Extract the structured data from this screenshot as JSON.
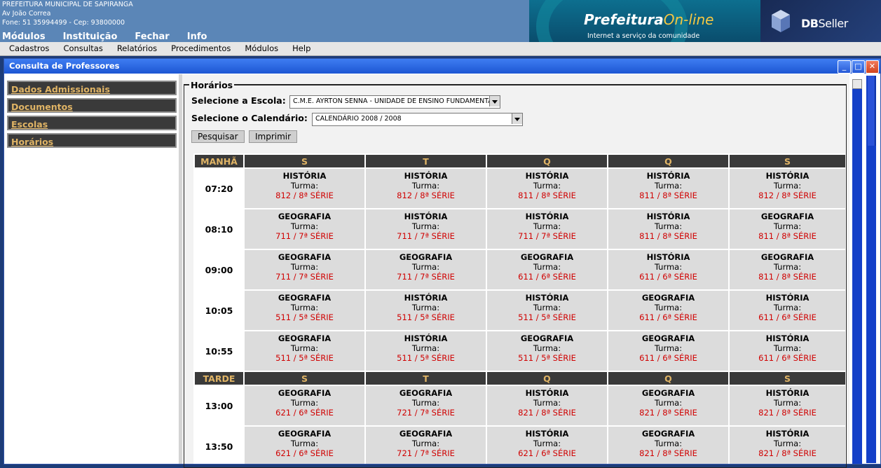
{
  "header": {
    "org_name": "PREFEITURA MUNICIPAL DE SAPIRANGA",
    "address": "Av João Correa",
    "phone": "Fone: 51 35994499  -  Cep: 93800000",
    "menu": [
      "Módulos",
      "Instituição",
      "Fechar",
      "Info"
    ],
    "banner_logo": "Prefeitura",
    "banner_logo_suffix": "On-line",
    "banner_slogan": "Internet a serviço da comunidade",
    "vendor_logo": "DB",
    "vendor_logo_suffix": "Seller"
  },
  "menubar": [
    "Cadastros",
    "Consultas",
    "Relatórios",
    "Procedimentos",
    "Módulos",
    "Help"
  ],
  "window": {
    "title": "Consulta de Professores",
    "minimize_icon": "_",
    "maximize_icon": "□",
    "close_icon": "✕"
  },
  "sidebar": {
    "items": [
      "Dados Admissionais",
      "Documentos",
      "Escolas",
      "Horários"
    ]
  },
  "form": {
    "legend": "Horários",
    "school_label": "Selecione a Escola:",
    "school_value": "C.M.E. AYRTON SENNA - UNIDADE DE ENSINO FUNDAMENTAL",
    "calendar_label": "Selecione o Calendário:",
    "calendar_value": "CALENDÁRIO 2008 / 2008",
    "search_button": "Pesquisar",
    "print_button": "Imprimir"
  },
  "schedule": {
    "turma_label": "Turma:",
    "days": [
      "S",
      "T",
      "Q",
      "Q",
      "S"
    ],
    "periods": [
      {
        "name": "MANHÃ",
        "rows": [
          {
            "time": "07:20",
            "cells": [
              {
                "subject": "HISTÓRIA",
                "class": "812 / 8ª SÉRIE"
              },
              {
                "subject": "HISTÓRIA",
                "class": "812 / 8ª SÉRIE"
              },
              {
                "subject": "HISTÓRIA",
                "class": "811 / 8ª SÉRIE"
              },
              {
                "subject": "HISTÓRIA",
                "class": "811 / 8ª SÉRIE"
              },
              {
                "subject": "HISTÓRIA",
                "class": "812 / 8ª SÉRIE"
              }
            ]
          },
          {
            "time": "08:10",
            "cells": [
              {
                "subject": "GEOGRAFIA",
                "class": "711 / 7ª SÉRIE"
              },
              {
                "subject": "HISTÓRIA",
                "class": "711 / 7ª SÉRIE"
              },
              {
                "subject": "HISTÓRIA",
                "class": "711 / 7ª SÉRIE"
              },
              {
                "subject": "HISTÓRIA",
                "class": "811 / 8ª SÉRIE"
              },
              {
                "subject": "GEOGRAFIA",
                "class": "811 / 8ª SÉRIE"
              }
            ]
          },
          {
            "time": "09:00",
            "cells": [
              {
                "subject": "GEOGRAFIA",
                "class": "711 / 7ª SÉRIE"
              },
              {
                "subject": "GEOGRAFIA",
                "class": "711 / 7ª SÉRIE"
              },
              {
                "subject": "GEOGRAFIA",
                "class": "611 / 6ª SÉRIE"
              },
              {
                "subject": "HISTÓRIA",
                "class": "611 / 6ª SÉRIE"
              },
              {
                "subject": "GEOGRAFIA",
                "class": "811 / 8ª SÉRIE"
              }
            ]
          },
          {
            "time": "10:05",
            "cells": [
              {
                "subject": "GEOGRAFIA",
                "class": "511 / 5ª SÉRIE"
              },
              {
                "subject": "HISTÓRIA",
                "class": "511 / 5ª SÉRIE"
              },
              {
                "subject": "HISTÓRIA",
                "class": "511 / 5ª SÉRIE"
              },
              {
                "subject": "GEOGRAFIA",
                "class": "611 / 6ª SÉRIE"
              },
              {
                "subject": "HISTÓRIA",
                "class": "611 / 6ª SÉRIE"
              }
            ]
          },
          {
            "time": "10:55",
            "cells": [
              {
                "subject": "GEOGRAFIA",
                "class": "511 / 5ª SÉRIE"
              },
              {
                "subject": "HISTÓRIA",
                "class": "511 / 5ª SÉRIE"
              },
              {
                "subject": "GEOGRAFIA",
                "class": "511 / 5ª SÉRIE"
              },
              {
                "subject": "GEOGRAFIA",
                "class": "611 / 6ª SÉRIE"
              },
              {
                "subject": "HISTÓRIA",
                "class": "611 / 6ª SÉRIE"
              }
            ]
          }
        ]
      },
      {
        "name": "TARDE",
        "rows": [
          {
            "time": "13:00",
            "cells": [
              {
                "subject": "GEOGRAFIA",
                "class": "621 / 6ª SÉRIE"
              },
              {
                "subject": "GEOGRAFIA",
                "class": "721 / 7ª SÉRIE"
              },
              {
                "subject": "HISTÓRIA",
                "class": "821 / 8ª SÉRIE"
              },
              {
                "subject": "GEOGRAFIA",
                "class": "821 / 8ª SÉRIE"
              },
              {
                "subject": "HISTÓRIA",
                "class": "821 / 8ª SÉRIE"
              }
            ]
          },
          {
            "time": "13:50",
            "cells": [
              {
                "subject": "GEOGRAFIA",
                "class": "621 / 6ª SÉRIE"
              },
              {
                "subject": "GEOGRAFIA",
                "class": "721 / 7ª SÉRIE"
              },
              {
                "subject": "HISTÓRIA",
                "class": "621 / 6ª SÉRIE"
              },
              {
                "subject": "GEOGRAFIA",
                "class": "821 / 8ª SÉRIE"
              },
              {
                "subject": "HISTÓRIA",
                "class": "821 / 8ª SÉRIE"
              }
            ]
          }
        ]
      }
    ]
  }
}
